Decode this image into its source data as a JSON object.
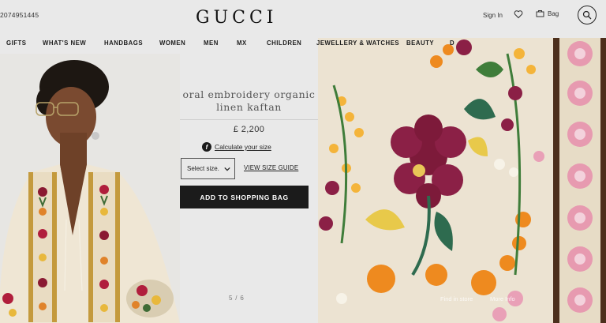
{
  "header": {
    "phone": "2074951445",
    "logo": "GUCCI",
    "sign_in": "Sign In",
    "bag_label": "Bag"
  },
  "nav": {
    "items": [
      "GIFTS",
      "WHAT'S NEW",
      "HANDBAGS",
      "WOMEN",
      "MEN",
      "MX",
      "CHILDREN",
      "JEWELLERY & WATCHES",
      "BEAUTY",
      "D"
    ]
  },
  "product": {
    "title_line1": "oral embroidery organic",
    "title_line2": "linen kaftan",
    "price": "£ 2,200",
    "calculate_size": "Calculate your size",
    "size_select": "Select size.",
    "size_guide": "VIEW SIZE GUIDE",
    "add_to_bag": "ADD TO SHOPPING BAG",
    "image_counter": "5 / 6"
  },
  "overlays": {
    "find_in_store": "Find in store",
    "more_info": "More Info"
  },
  "icons": {
    "heart": "heart-icon",
    "bag": "shopping-bag-icon",
    "search": "search-icon",
    "calculator": "size-calculator-icon",
    "dropdown": "chevron-down-icon"
  },
  "colors": {
    "button_bg": "#1b1b1b",
    "page_bg": "#e9e9e9"
  }
}
